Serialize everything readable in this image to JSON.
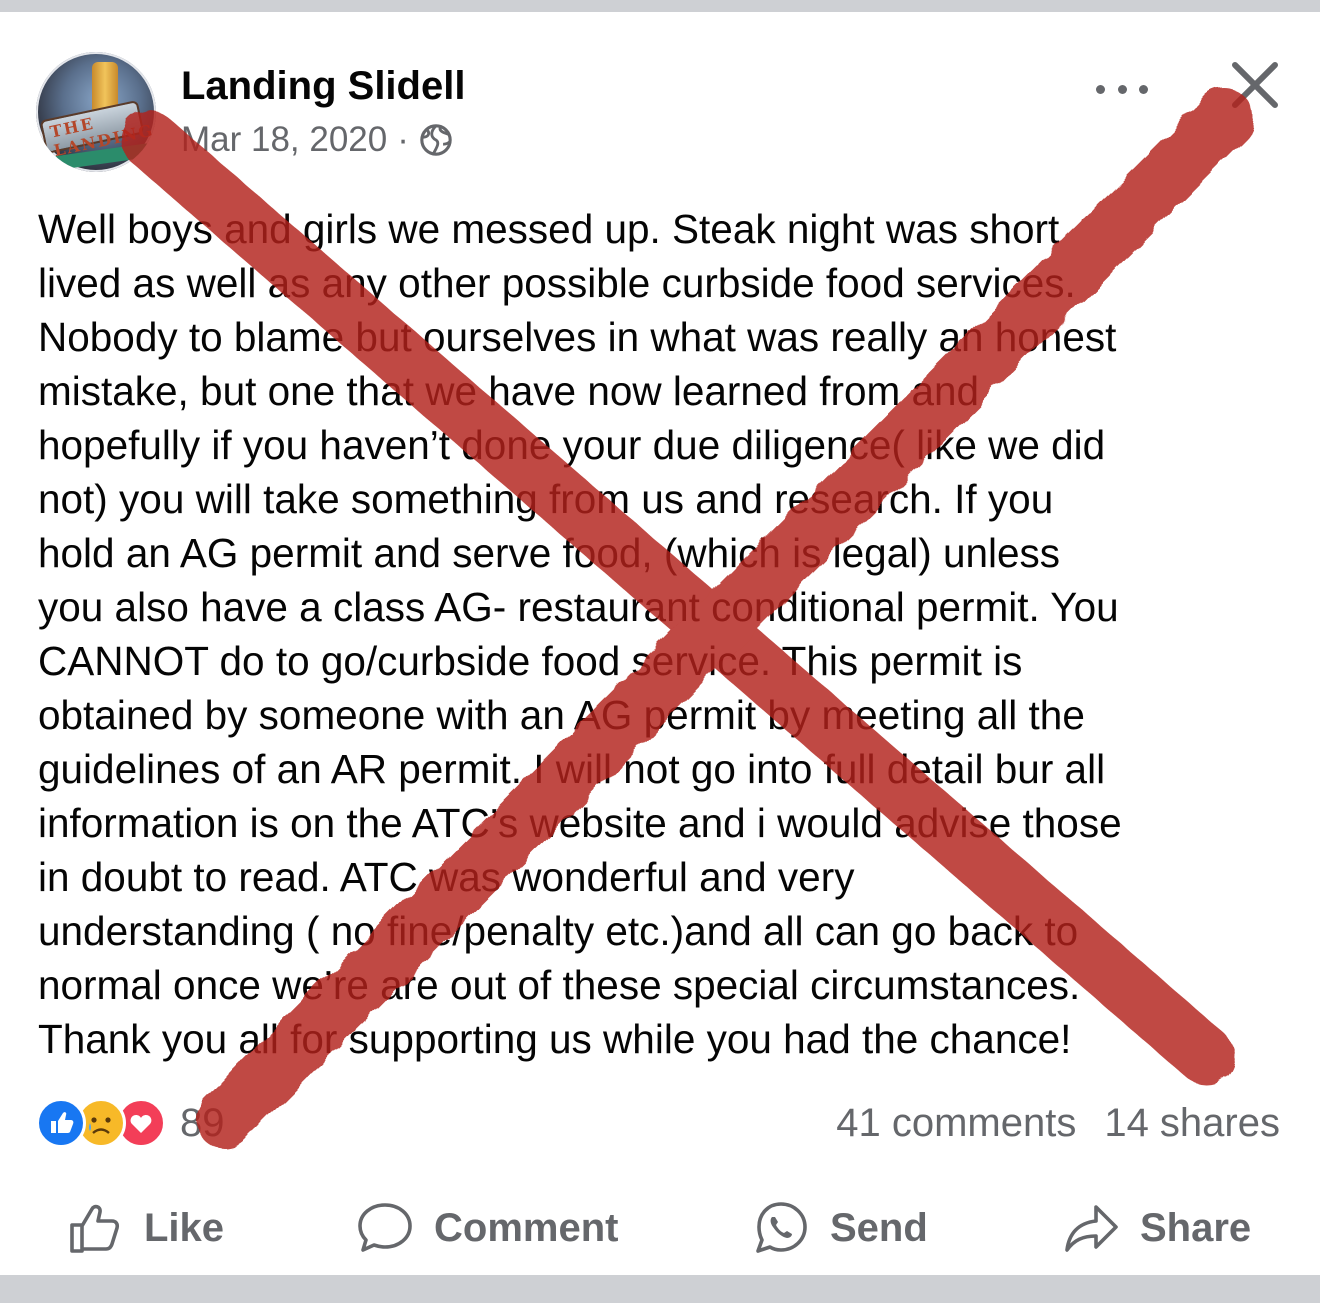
{
  "post": {
    "page_name": "Landing Slidell",
    "date": "Mar 18, 2020",
    "separator": "·",
    "privacy_icon": "globe-icon",
    "avatar_sign": "THE LANDING",
    "body_lines": [
      "Well boys and girls we messed up. Steak night was short",
      "lived as well as any other possible curbside food services.",
      "Nobody to blame but ourselves in what was really an honest",
      "mistake, but one that we have now learned from and",
      "hopefully if you haven’t done your due diligence( like we did",
      "not) you will take something from us and research. If you",
      "hold an AG permit and serve food, (which is legal) unless",
      "you also have a class AG- restaurant conditional permit. You",
      "CANNOT do to go/curbside food service. This permit is",
      "obtained by someone with an AG permit by meeting all the",
      "guidelines of an AR permit. I will not go into full detail bur all",
      "information is on the ATC’s website and i would advise those",
      "in doubt to read.  ATC was wonderful and very",
      "understanding ( no fine/penalty etc.)and all can go back to",
      "normal once we’re are out of these special circumstances.",
      "Thank you all for supporting us while you had the chance!"
    ]
  },
  "engagement": {
    "reaction_icons": [
      "like-reaction-icon",
      "sad-reaction-icon",
      "love-reaction-icon"
    ],
    "reaction_count": "89",
    "comments": "41 comments",
    "shares": "14 shares"
  },
  "actions": {
    "like": "Like",
    "comment": "Comment",
    "send": "Send",
    "share": "Share"
  },
  "colors": {
    "brand_blue": "#1877f2",
    "secondary_text": "#65676b",
    "overlay_red": "#b3201a"
  }
}
